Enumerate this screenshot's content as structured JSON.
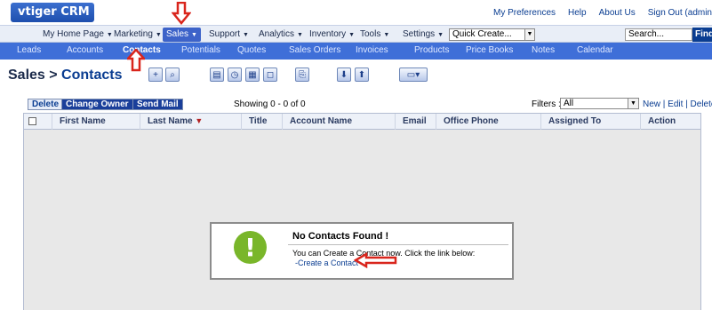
{
  "app": {
    "logo": "vtiger CRM 5"
  },
  "top_links": [
    "My Preferences",
    "Help",
    "About Us",
    "Sign Out (admin"
  ],
  "modules": {
    "items": [
      {
        "label": "My Home Page"
      },
      {
        "label": "Marketing"
      },
      {
        "label": "Sales"
      },
      {
        "label": "Support"
      },
      {
        "label": "Analytics"
      },
      {
        "label": "Inventory"
      },
      {
        "label": "Tools"
      },
      {
        "label": "Settings"
      }
    ],
    "quick_create": "Quick Create...",
    "search_placeholder": "Search...",
    "find_label": "Find"
  },
  "subtabs": [
    "Leads",
    "Accounts",
    "Contacts",
    "Potentials",
    "Quotes",
    "Sales Orders",
    "Invoices",
    "Products",
    "Price Books",
    "Notes",
    "Calendar"
  ],
  "page": {
    "module": "Sales",
    "separator": " > ",
    "title": "Contacts"
  },
  "toolbar_icons": [
    "add-icon",
    "search-icon",
    "calendar-icon",
    "clock-icon",
    "calculator-icon",
    "chat-icon",
    "import-icon",
    "export-down-icon",
    "export-up-icon",
    "view-options-icon"
  ],
  "actions": {
    "delete": "Delete",
    "change_owner": "Change Owner",
    "send_mail": "Send Mail",
    "showing": "Showing 0 - 0 of 0",
    "filters_label": "Filters :",
    "filter_value": "All",
    "view_links": "New | Edit | Delete"
  },
  "table": {
    "columns": [
      "First Name",
      "Last Name",
      "Title",
      "Account Name",
      "Email",
      "Office Phone",
      "Assigned To",
      "Action"
    ]
  },
  "empty": {
    "title": "No Contacts Found !",
    "message": "You can Create a Contact now. Click the link below:",
    "link": "-Create a Contact"
  },
  "colors": {
    "brand": "#3f6fd8",
    "dark": "#1a3f9a",
    "arrow": "#d9251c",
    "success": "#79b62a"
  }
}
